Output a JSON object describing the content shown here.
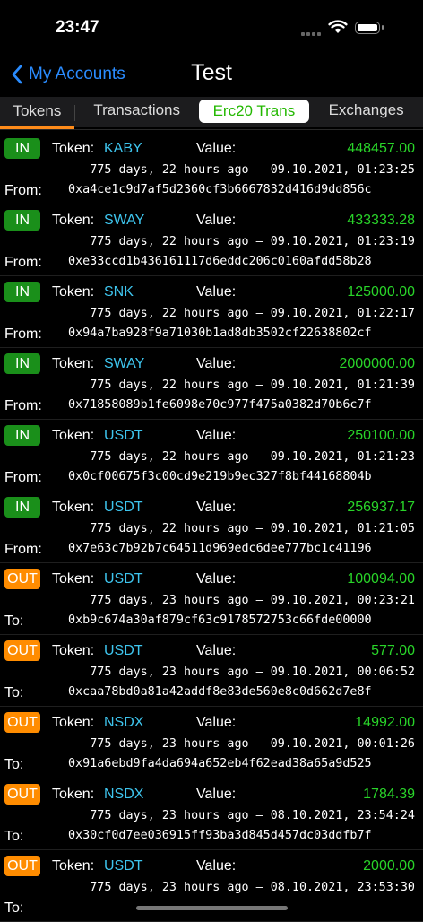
{
  "status": {
    "time": "23:47"
  },
  "nav": {
    "back_label": "My Accounts",
    "title": "Test"
  },
  "tabs": [
    "Tokens",
    "Transactions",
    "Erc20 Trans",
    "Exchanges"
  ],
  "labels": {
    "token": "Token:",
    "value": "Value:",
    "from": "From:",
    "to": "To:"
  },
  "transactions": [
    {
      "dir": "IN",
      "token": "KABY",
      "value": "448457.00",
      "date": "775 days, 22 hours ago – 09.10.2021, 01:23:25",
      "party_label": "From:",
      "address": "0xa4ce1c9d7af5d2360cf3b6667832d416d9dd856c"
    },
    {
      "dir": "IN",
      "token": "SWAY",
      "value": "433333.28",
      "date": "775 days, 22 hours ago – 09.10.2021, 01:23:19",
      "party_label": "From:",
      "address": "0xe33ccd1b436161117d6eddc206c0160afdd58b28"
    },
    {
      "dir": "IN",
      "token": "SNK",
      "value": "125000.00",
      "date": "775 days, 22 hours ago – 09.10.2021, 01:22:17",
      "party_label": "From:",
      "address": "0x94a7ba928f9a71030b1ad8db3502cf22638802cf"
    },
    {
      "dir": "IN",
      "token": "SWAY",
      "value": "2000000.00",
      "date": "775 days, 22 hours ago – 09.10.2021, 01:21:39",
      "party_label": "From:",
      "address": "0x71858089b1fe6098e70c977f475a0382d70b6c7f"
    },
    {
      "dir": "IN",
      "token": "USDT",
      "value": "250100.00",
      "date": "775 days, 22 hours ago – 09.10.2021, 01:21:23",
      "party_label": "From:",
      "address": "0x0cf00675f3c00cd9e219b9ec327f8bf44168804b"
    },
    {
      "dir": "IN",
      "token": "USDT",
      "value": "256937.17",
      "date": "775 days, 22 hours ago – 09.10.2021, 01:21:05",
      "party_label": "From:",
      "address": "0x7e63c7b92b7c64511d969edc6dee777bc1c41196"
    },
    {
      "dir": "OUT",
      "token": "USDT",
      "value": "100094.00",
      "date": "775 days, 23 hours ago – 09.10.2021, 00:23:21",
      "party_label": "To:",
      "address": "0xb9c674a30af879cf63c9178572753c66fde00000"
    },
    {
      "dir": "OUT",
      "token": "USDT",
      "value": "577.00",
      "date": "775 days, 23 hours ago – 09.10.2021, 00:06:52",
      "party_label": "To:",
      "address": "0xcaa78bd0a81a42addf8e83de560e8c0d662d7e8f"
    },
    {
      "dir": "OUT",
      "token": "NSDX",
      "value": "14992.00",
      "date": "775 days, 23 hours ago – 09.10.2021, 00:01:26",
      "party_label": "To:",
      "address": "0x91a6ebd9fa4da694a652eb4f62ead38a65a9d525"
    },
    {
      "dir": "OUT",
      "token": "NSDX",
      "value": "1784.39",
      "date": "775 days, 23 hours ago – 08.10.2021, 23:54:24",
      "party_label": "To:",
      "address": "0x30cf0d7ee036915ff93ba3d845d457dc03ddfb7f"
    },
    {
      "dir": "OUT",
      "token": "USDT",
      "value": "2000.00",
      "date": "775 days, 23 hours ago – 08.10.2021, 23:53:30",
      "party_label": "To:",
      "address": ""
    }
  ],
  "colors": {
    "in_badge": "#1a8f1a",
    "out_badge": "#ff8c00",
    "token": "#3ec5ee",
    "amount": "#29d429",
    "accent": "#ff8c1a",
    "link": "#2a8cff"
  }
}
